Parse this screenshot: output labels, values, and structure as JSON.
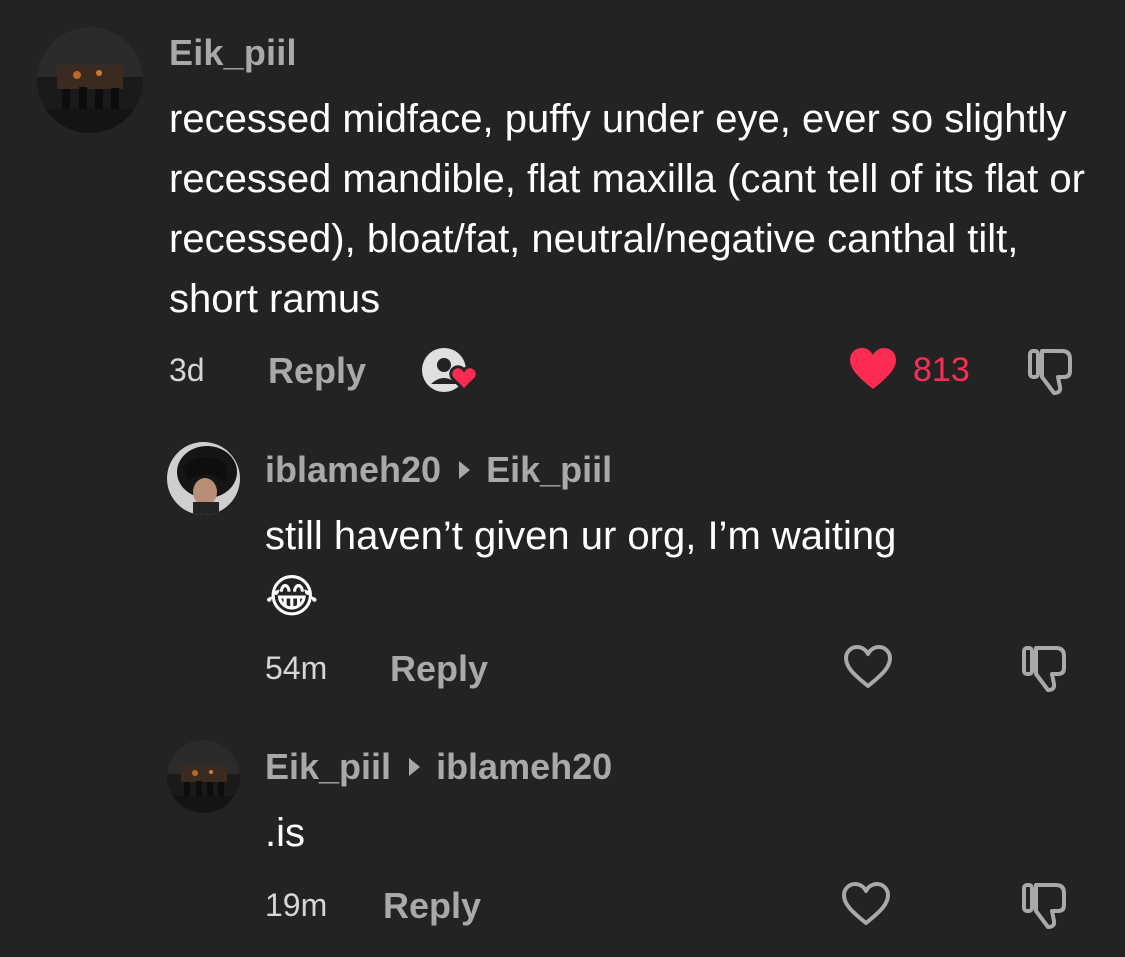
{
  "comments": [
    {
      "username": "Eik_piil",
      "text": "recessed midface, puffy under eye, ever so slightly recessed mandible, flat maxilla (cant tell of its flat or recessed), bloat/fat, neutral/negative canthal tilt, short ramus",
      "time": "3d",
      "reply_label": "Reply",
      "like_count": "813",
      "liked": true,
      "creator_liked_icon": "creator-liked-heart-icon",
      "like_icon": "heart-filled-icon",
      "dislike_icon": "thumbs-down-icon"
    },
    {
      "username": "iblameh20",
      "reply_to": "Eik_piil",
      "text": "still haven’t given ur org, I’m waiting",
      "emoji": "😂",
      "time": "54m",
      "reply_label": "Reply",
      "liked": false,
      "like_icon": "heart-outline-icon",
      "dislike_icon": "thumbs-down-icon"
    },
    {
      "username": "Eik_piil",
      "reply_to": "iblameh20",
      "text": ".is",
      "time": "19m",
      "reply_label": "Reply",
      "liked": false,
      "like_icon": "heart-outline-icon",
      "dislike_icon": "thumbs-down-icon"
    }
  ],
  "colors": {
    "background": "#232323",
    "muted": "#a9a9a9",
    "like_red": "#fe2c55"
  }
}
